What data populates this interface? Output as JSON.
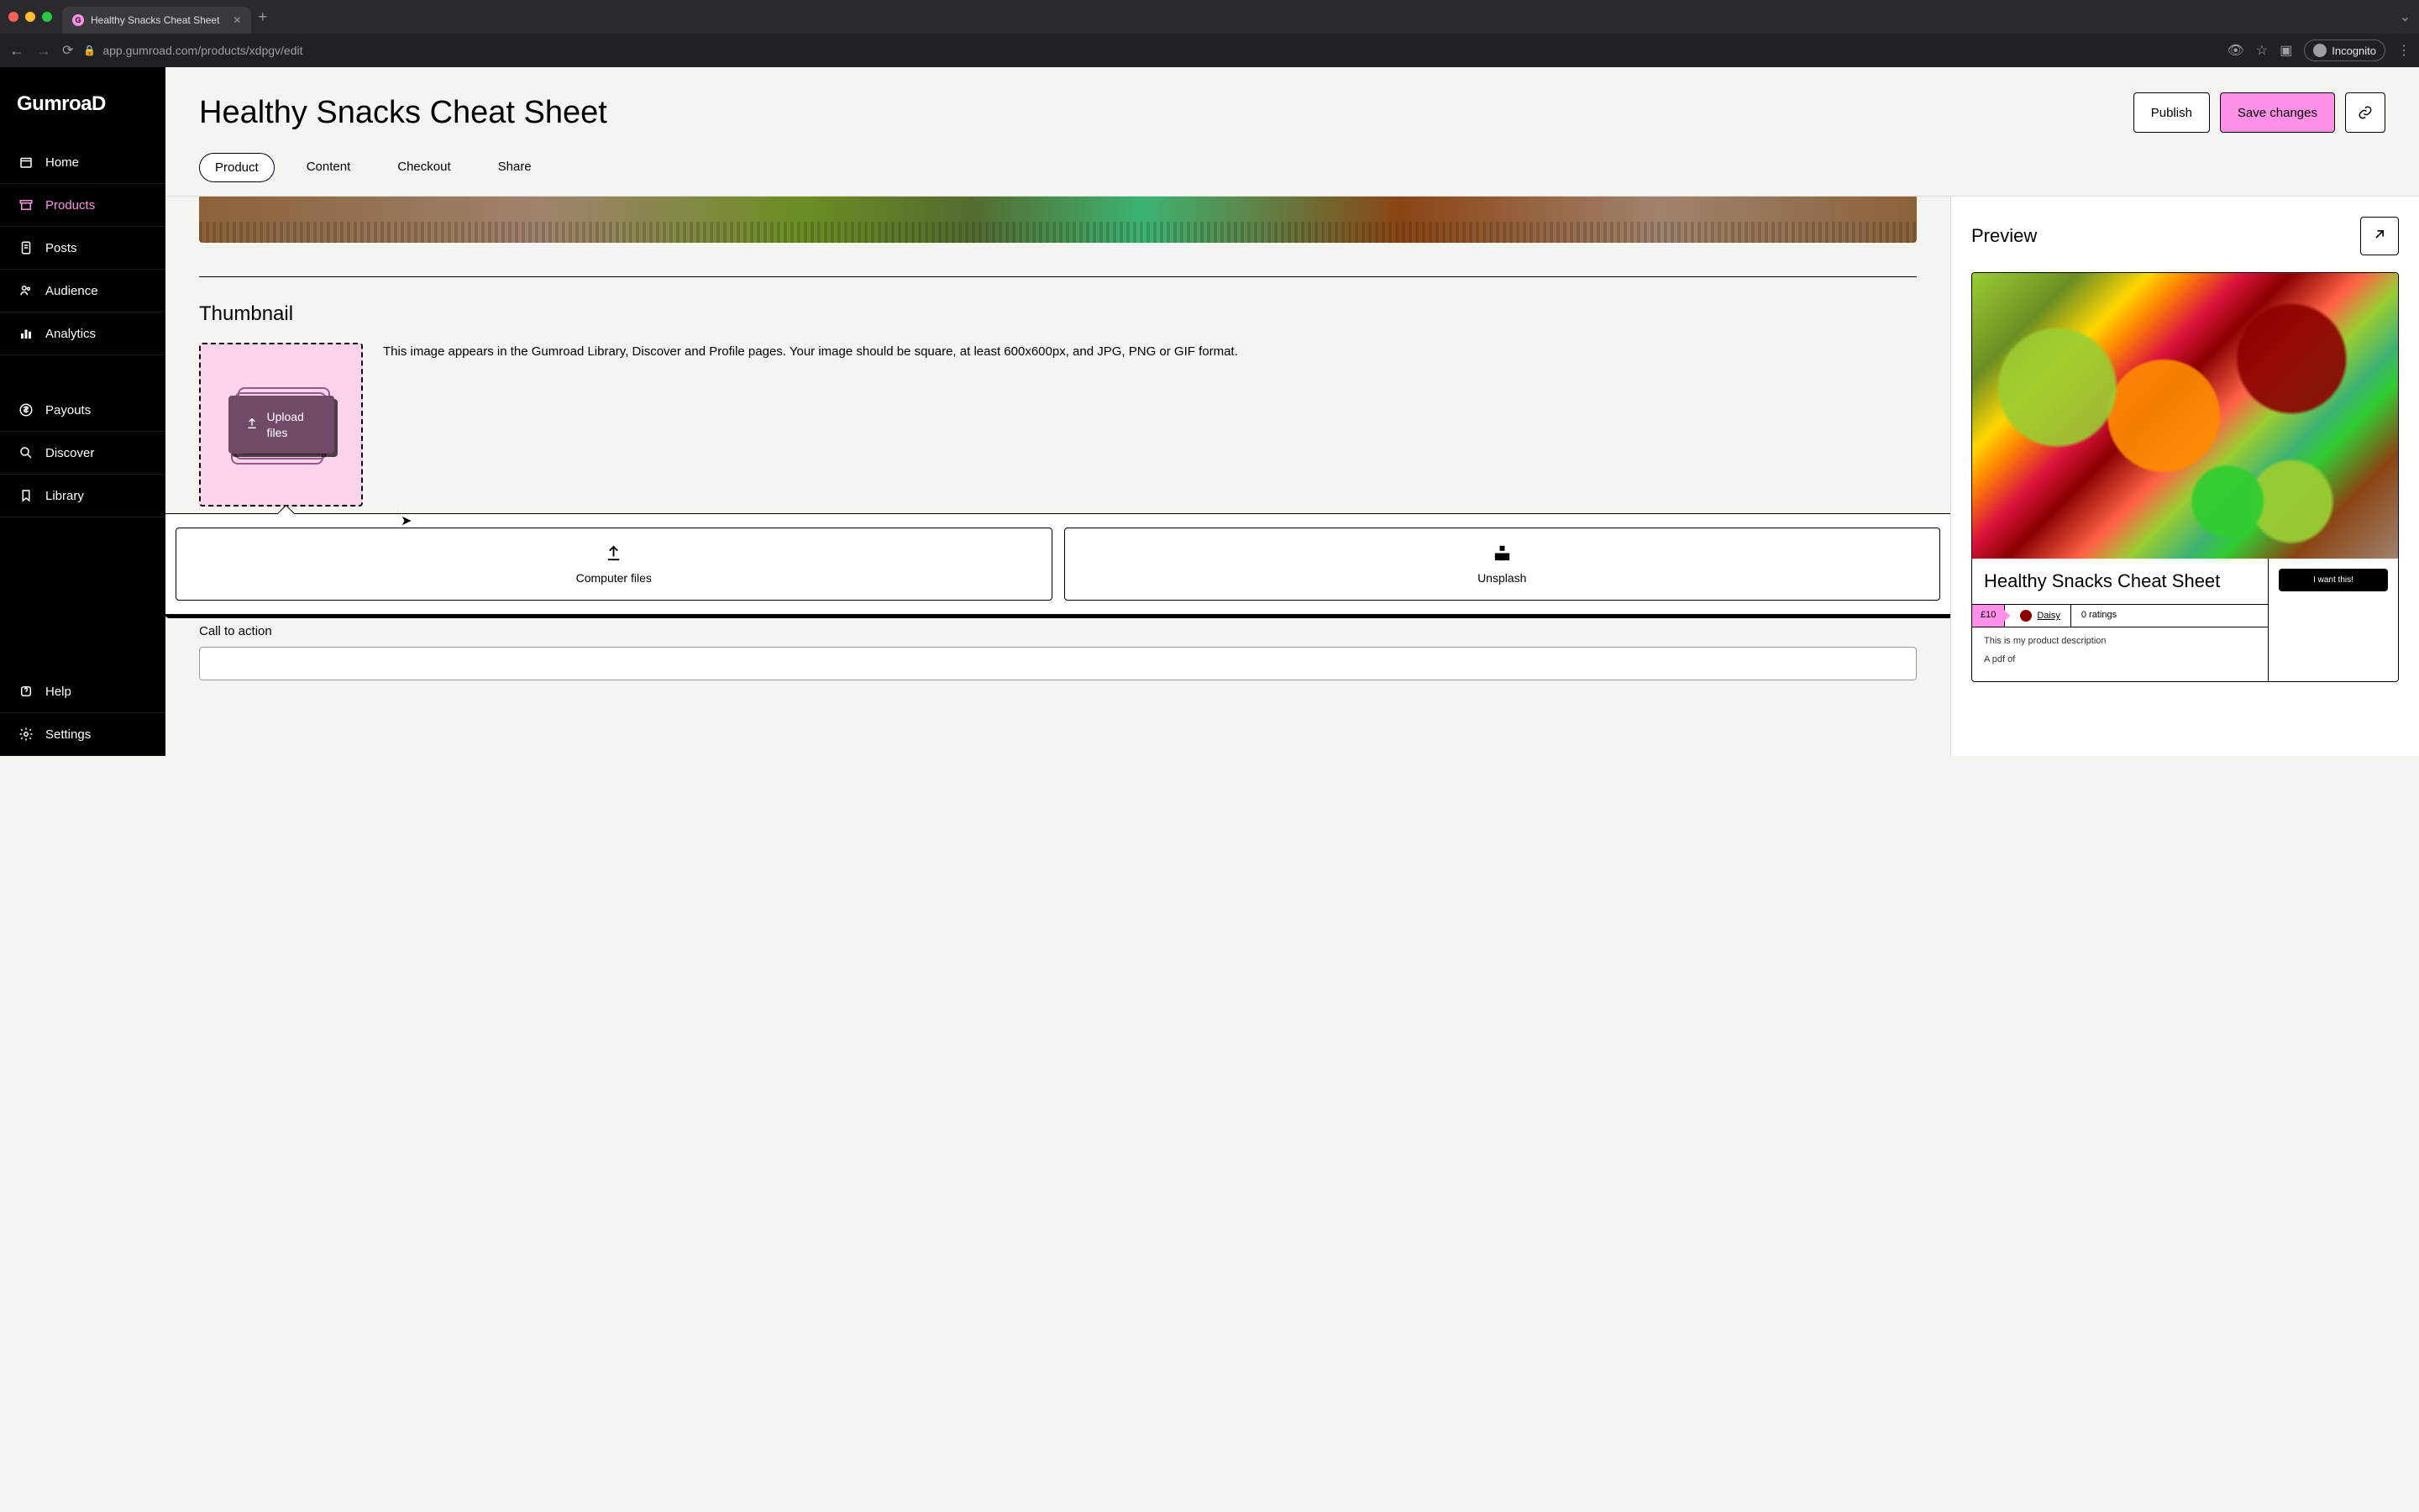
{
  "browser": {
    "tab_title": "Healthy Snacks Cheat Sheet",
    "url": "app.gumroad.com/products/xdpgv/edit",
    "incognito_label": "Incognito"
  },
  "brand": "GumroaD",
  "sidebar": {
    "items": [
      {
        "icon": "home",
        "label": "Home"
      },
      {
        "icon": "archive",
        "label": "Products"
      },
      {
        "icon": "file",
        "label": "Posts"
      },
      {
        "icon": "users",
        "label": "Audience"
      },
      {
        "icon": "chart",
        "label": "Analytics"
      },
      {
        "icon": "dollar",
        "label": "Payouts"
      },
      {
        "icon": "search",
        "label": "Discover"
      },
      {
        "icon": "bookmark",
        "label": "Library"
      },
      {
        "icon": "help",
        "label": "Help"
      },
      {
        "icon": "gear",
        "label": "Settings"
      }
    ]
  },
  "header": {
    "title": "Healthy Snacks Cheat Sheet",
    "publish": "Publish",
    "save": "Save changes"
  },
  "tabs": [
    {
      "label": "Product",
      "active": true
    },
    {
      "label": "Content"
    },
    {
      "label": "Checkout"
    },
    {
      "label": "Share"
    }
  ],
  "editor": {
    "thumbnail_title": "Thumbnail",
    "upload_label": "Upload files",
    "thumbnail_help": "This image appears in the Gumroad Library, Discover and Profile pages. Your image should be square, at least 600x600px, and JPG, PNG or GIF format.",
    "popover": {
      "computer": "Computer files",
      "unsplash": "Unsplash"
    },
    "cta_label": "Call to action"
  },
  "preview": {
    "title": "Preview",
    "product_title": "Healthy Snacks Cheat Sheet",
    "price": "£10",
    "author": "Daisy",
    "ratings": "0 ratings",
    "desc1": "This is my product description",
    "desc2": "A pdf of",
    "want": "I want this!"
  },
  "colors": {
    "accent": "#ff90e8"
  }
}
